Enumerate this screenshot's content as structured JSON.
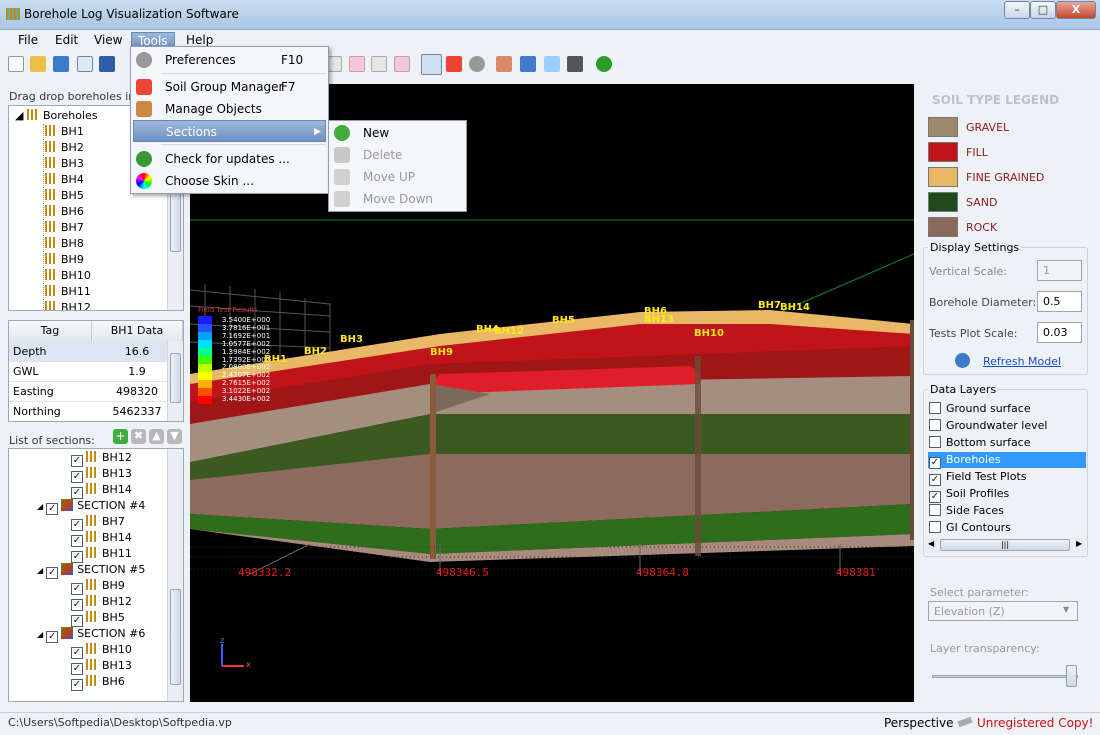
{
  "window": {
    "title": "Borehole Log Visualization Software",
    "min": "–",
    "max": "□",
    "close": "X"
  },
  "menubar": [
    "File",
    "Edit",
    "View",
    "Tools",
    "Help"
  ],
  "tools_menu": [
    {
      "label": "Preferences",
      "shortcut": "F10"
    },
    {
      "label": "Soil Group Manager",
      "shortcut": "F7"
    },
    {
      "label": "Manage Objects",
      "shortcut": ""
    },
    {
      "label": "Sections",
      "shortcut": ""
    },
    {
      "label": "Check for updates ...",
      "shortcut": ""
    },
    {
      "label": "Choose Skin ...",
      "shortcut": ""
    }
  ],
  "sections_submenu": [
    "New",
    "Delete",
    "Move UP",
    "Move Down"
  ],
  "left": {
    "drag_hint": "Drag  drop boreholes into",
    "tree_root": "Boreholes",
    "boreholes": [
      "BH1",
      "BH2",
      "BH3",
      "BH4",
      "BH5",
      "BH6",
      "BH7",
      "BH8",
      "BH9",
      "BH10",
      "BH11",
      "BH12"
    ],
    "props_header": [
      "Tag",
      "BH1 Data"
    ],
    "props": [
      {
        "k": "Depth",
        "v": "16.6"
      },
      {
        "k": "GWL",
        "v": "1.9"
      },
      {
        "k": "Easting",
        "v": "498320"
      },
      {
        "k": "Northing",
        "v": "5462337"
      }
    ],
    "sections_label": "List of sections:",
    "sections_tree": [
      {
        "type": "bh",
        "label": "BH12"
      },
      {
        "type": "bh",
        "label": "BH13"
      },
      {
        "type": "bh",
        "label": "BH14"
      },
      {
        "type": "sec",
        "label": "SECTION #4"
      },
      {
        "type": "bh",
        "label": "BH7"
      },
      {
        "type": "bh",
        "label": "BH14"
      },
      {
        "type": "bh",
        "label": "BH11"
      },
      {
        "type": "sec",
        "label": "SECTION #5"
      },
      {
        "type": "bh",
        "label": "BH9"
      },
      {
        "type": "bh",
        "label": "BH12"
      },
      {
        "type": "bh",
        "label": "BH5"
      },
      {
        "type": "sec",
        "label": "SECTION #6"
      },
      {
        "type": "bh",
        "label": "BH10"
      },
      {
        "type": "bh",
        "label": "BH13"
      },
      {
        "type": "bh",
        "label": "BH6"
      }
    ]
  },
  "viewport": {
    "field_test_title": "Field Test Results",
    "field_test_values": [
      "3.5400E+000",
      "3.7816E+001",
      "7.1692E+001",
      "1.0577E+002",
      "1.3984E+002",
      "1.7392E+002",
      "2.0800E+002",
      "2.4207E+002",
      "2.7615E+002",
      "3.1022E+002",
      "3.4430E+002"
    ],
    "field_test_colors": [
      "#1a1aff",
      "#2255ff",
      "#00a0ff",
      "#00e0ff",
      "#00ff90",
      "#40ff00",
      "#c0ff00",
      "#ffff00",
      "#ffb000",
      "#ff5000",
      "#ff0000"
    ],
    "axis_labels": [
      "498332.2",
      "498346.5",
      "498364.8",
      "498381"
    ],
    "bh_labels": [
      "BH1",
      "BH2",
      "BH3",
      "BH4",
      "BH12",
      "BH5",
      "BH9",
      "BH6",
      "BH13",
      "BH10",
      "BH7",
      "BH14"
    ],
    "axis_letters": {
      "z": "z",
      "x": "x"
    }
  },
  "legend": {
    "title": "SOIL TYPE LEGEND",
    "items": [
      {
        "label": "GRAVEL",
        "color": "#9b8a6d"
      },
      {
        "label": "FILL",
        "color": "#c0141a"
      },
      {
        "label": "FINE GRAINED",
        "color": "#e8b866"
      },
      {
        "label": "SAND",
        "color": "#1e4a1e"
      },
      {
        "label": "ROCK",
        "color": "#8a6a5a"
      }
    ]
  },
  "display_settings": {
    "title": "Display Settings",
    "vertical_scale_label": "Vertical Scale:",
    "vertical_scale": "1",
    "diameter_label": "Borehole Diameter:",
    "diameter": "0.5",
    "tests_scale_label": "Tests Plot Scale:",
    "tests_scale": "0.03",
    "refresh": "Refresh Model"
  },
  "data_layers": {
    "title": "Data Layers",
    "items": [
      {
        "label": "Ground surface",
        "checked": false
      },
      {
        "label": "Groundwater level",
        "checked": false
      },
      {
        "label": "Bottom surface",
        "checked": false
      },
      {
        "label": "Boreholes",
        "checked": true,
        "selected": true
      },
      {
        "label": "Field Test Plots",
        "checked": true
      },
      {
        "label": "Soil Profiles",
        "checked": true
      },
      {
        "label": "Side Faces",
        "checked": false
      },
      {
        "label": "GI Contours",
        "checked": false
      }
    ],
    "select_param_label": "Select parameter:",
    "select_param_value": "Elevation (Z)",
    "transparency_label": "Layer transparency:"
  },
  "status": {
    "path": "C:\\Users\\Softpedia\\Desktop\\Softpedia.vp",
    "mode": "Perspective",
    "reg": "Unregistered Copy!"
  }
}
